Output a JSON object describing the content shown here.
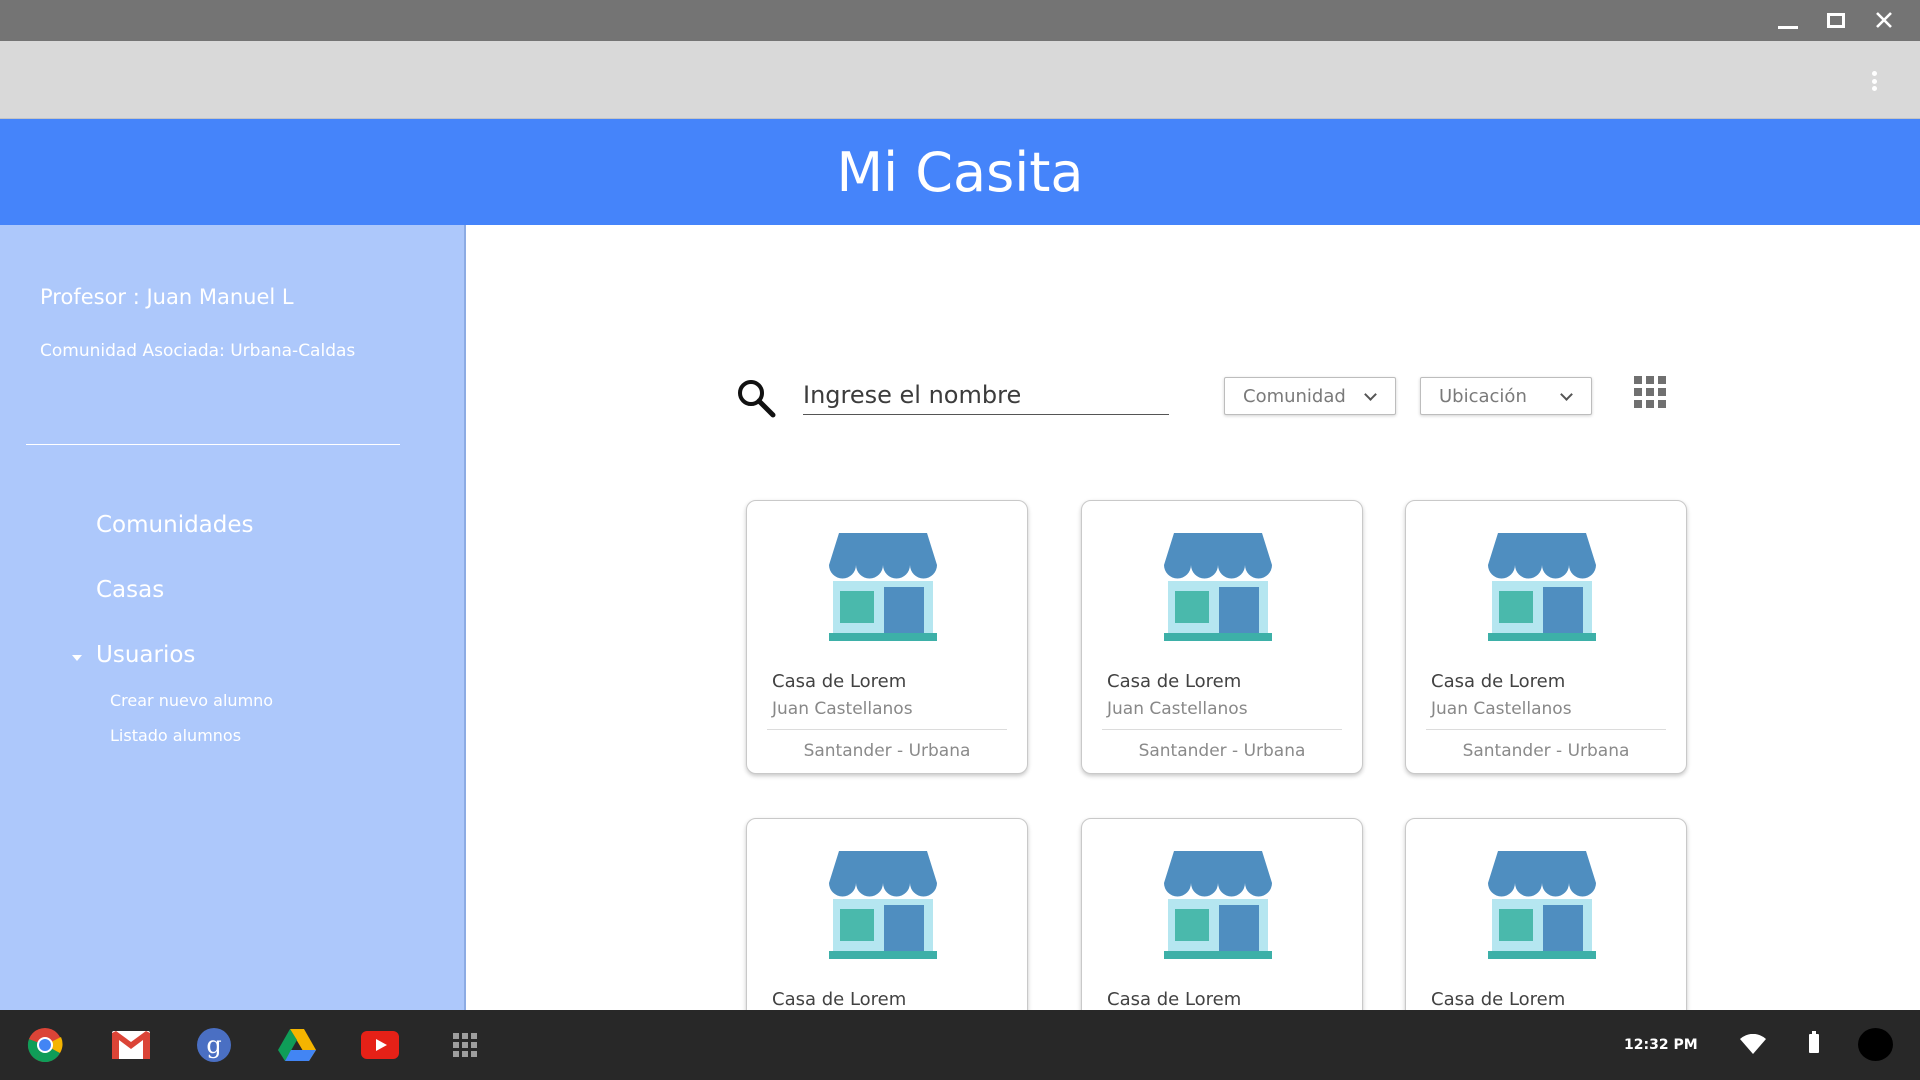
{
  "app": {
    "title": "Mi Casita",
    "accent": "#4584fa",
    "sidebar_color": "#adc8fb"
  },
  "sidebar": {
    "profesor": "Profesor : Juan Manuel L",
    "comunidad": "Comunidad Asociada: Urbana-Caldas",
    "items": [
      {
        "label": "Comunidades"
      },
      {
        "label": "Casas"
      },
      {
        "label": "Usuarios",
        "expanded": true,
        "children": [
          {
            "label": "Crear nuevo alumno"
          },
          {
            "label": "Listado alumnos"
          }
        ]
      }
    ]
  },
  "search": {
    "placeholder": "Ingrese el nombre",
    "filters": [
      {
        "label": "Comunidad"
      },
      {
        "label": "Ubicación"
      }
    ],
    "view_icon": "grid-view-icon"
  },
  "cards": [
    {
      "title": "Casa de Lorem",
      "owner": "Juan Castellanos",
      "location": "Santander - Urbana",
      "icon": "house-icon"
    },
    {
      "title": "Casa de Lorem",
      "owner": "Juan Castellanos",
      "location": "Santander - Urbana",
      "icon": "house-icon"
    },
    {
      "title": "Casa de Lorem",
      "owner": "Juan Castellanos",
      "location": "Santander - Urbana",
      "icon": "house-icon"
    },
    {
      "title": "Casa de Lorem",
      "owner": "",
      "location": "",
      "icon": "house-icon"
    },
    {
      "title": "Casa de Lorem",
      "owner": "",
      "location": "",
      "icon": "house-icon"
    },
    {
      "title": "Casa de Lorem",
      "owner": "",
      "location": "",
      "icon": "house-icon"
    }
  ],
  "taskbar": {
    "apps": [
      "chrome-icon",
      "gmail-icon",
      "google-plus-icon",
      "drive-icon",
      "youtube-icon",
      "app-launcher-icon"
    ],
    "clock": "12:32 PM"
  }
}
